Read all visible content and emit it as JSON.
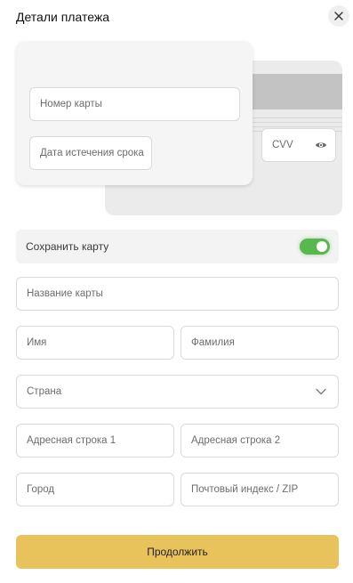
{
  "header": {
    "title": "Детали платежа",
    "close_icon": "close-icon"
  },
  "card": {
    "number_placeholder": "Номер карты",
    "expiry_placeholder": "Дата истечения срока",
    "cvv_placeholder": "CVV",
    "cvv_visibility_icon": "eye-icon"
  },
  "save_card": {
    "label": "Сохранить карту",
    "enabled": true
  },
  "form": {
    "card_name_placeholder": "Название карты",
    "first_name_placeholder": "Имя",
    "last_name_placeholder": "Фамилия",
    "country_placeholder": "Страна",
    "country_icon": "chevron-down-icon",
    "address1_placeholder": "Адресная строка 1",
    "address2_placeholder": "Адресная строка 2",
    "city_placeholder": "Город",
    "zip_placeholder": "Почтовый индекс / ZIP"
  },
  "actions": {
    "continue_label": "Продолжить"
  },
  "colors": {
    "toggle_on": "#58b84e",
    "primary_button": "#e8c25a"
  }
}
